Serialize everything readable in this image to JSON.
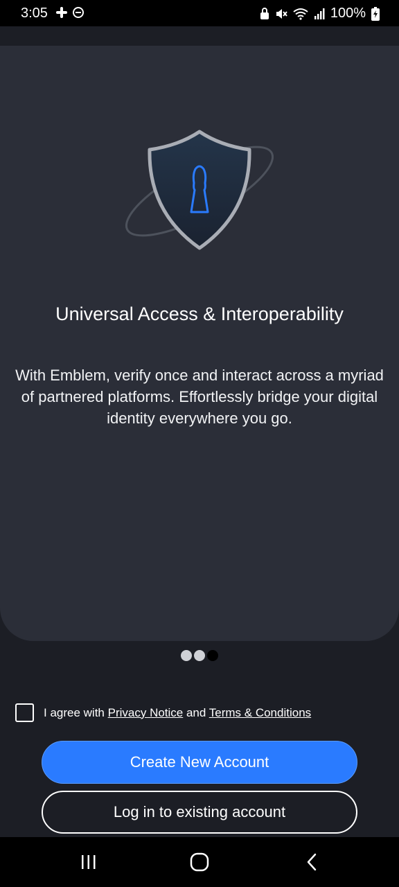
{
  "status_bar": {
    "time": "3:05",
    "battery_text": "100%",
    "icons": [
      "slack-icon",
      "do-not-disturb-icon",
      "lock-icon",
      "mute-icon",
      "wifi-icon",
      "signal-icon",
      "battery-charging-icon"
    ]
  },
  "onboarding": {
    "hero_icon": "shield-keyhole-icon",
    "title": "Universal Access & Interoperability",
    "description": "With Emblem, verify once and interact across a myriad of partnered platforms. Effortlessly bridge your digital identity everywhere you go.",
    "page_count": 3,
    "active_page": 3
  },
  "agreement": {
    "checked": false,
    "prefix": "I agree with ",
    "privacy_link": "Privacy Notice",
    "conjunction": " and ",
    "terms_link": "Terms & Conditions"
  },
  "actions": {
    "create_label": "Create New Account",
    "login_label": "Log in to existing account"
  },
  "colors": {
    "background": "#1c1e25",
    "card": "#2b2e38",
    "accent": "#2a7bff"
  },
  "nav_bar": {
    "icons": [
      "recents-icon",
      "home-icon",
      "back-icon"
    ]
  }
}
